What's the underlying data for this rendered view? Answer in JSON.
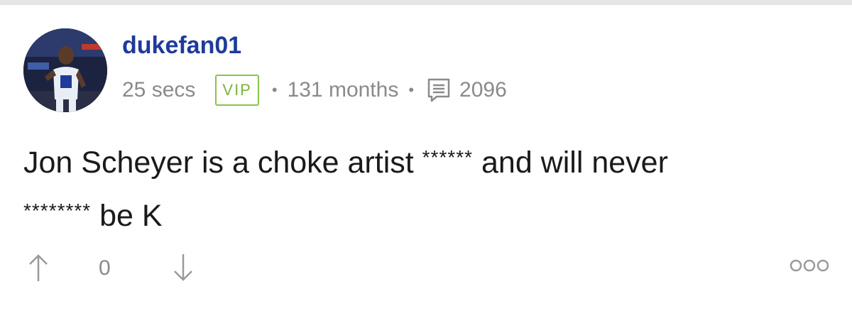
{
  "comment": {
    "username": "dukefan01",
    "time_ago": "25 secs",
    "badge": "VIP",
    "tenure": "131 months",
    "post_count": "2096",
    "body_part1": "Jon Scheyer is a choke artist ",
    "censor1": "******",
    "body_part2": " and will never ",
    "censor2": "********",
    "body_part3": " be K",
    "vote_count": "0"
  },
  "icons": {
    "avatar": "avatar-image",
    "post_count": "message-icon",
    "upvote": "arrow-up-icon",
    "downvote": "arrow-down-icon",
    "more": "more-options-icon"
  },
  "colors": {
    "username": "#1f3a9a",
    "meta": "#8a8a8a",
    "vip": "#7cb342",
    "body": "#1a1a1a"
  }
}
